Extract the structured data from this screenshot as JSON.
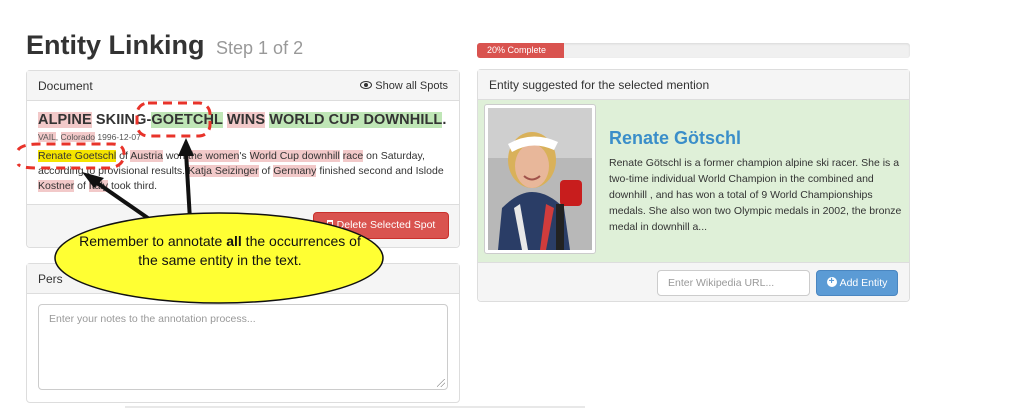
{
  "header": {
    "title": "Entity Linking",
    "step": "Step 1 of 2"
  },
  "progress": {
    "label": "20% Complete",
    "value": 20
  },
  "document_panel": {
    "heading": "Document",
    "show_spots": "Show all Spots",
    "headline": {
      "w1": "ALPINE",
      "w2": " SKIING-",
      "w3": "GOETCHL",
      "w4": " ",
      "w5": "WINS",
      "w6": " ",
      "w7": "WORLD CUP DOWNHILL",
      "w8": "."
    },
    "dateline": {
      "d1": "VAIL",
      "d2": ", ",
      "d3": "Colorado",
      "d4": " 1996-12-07"
    },
    "body": {
      "s1": "Renate Goetschl",
      "s2": " of ",
      "s3": "Austria",
      "s4": " won ",
      "s5": "the women",
      "s6": "'s ",
      "s7": "World Cup downhill",
      "s8": " ",
      "s9": "race",
      "s10": " on Saturday, according to provisional results. ",
      "s11": "Katja Seizinger",
      "s12": " of ",
      "s13": "Germany",
      "s14": " finished second and Islode ",
      "s15": "Kostner",
      "s16": " of ",
      "s17": "Italy",
      "s18": " took third."
    },
    "delete_button": "Delete Selected Spot"
  },
  "notes_panel": {
    "heading": "Pers",
    "placeholder": "Enter your notes to the annotation process..."
  },
  "entity_panel": {
    "heading": "Entity suggested for the selected mention",
    "name": "Renate Götschl",
    "description": "Renate Götschl is a former champion alpine ski racer. She is a two-time individual World Champion in the combined and downhill , and has won a total of 9 World Championships medals. She also won two Olympic medals in 2002, the bronze medal in downhill a...",
    "url_placeholder": "Enter Wikipedia URL...",
    "add_button": "Add Entity"
  },
  "callout": {
    "p1": "Remember to annotate ",
    "p2": "all",
    "p3": " the occurrences of the same entity in the text."
  },
  "colors": {
    "danger": "#d9534f",
    "primary": "#5b9bd5",
    "entity_name": "#3a8ec9",
    "success_bg": "#dff0d8",
    "callout_fill": "#ffff33",
    "callout_dash": "#e8332a"
  },
  "icons": {
    "show_spots": "eye-icon",
    "delete": "trash-icon",
    "add": "plus-circle-icon"
  }
}
